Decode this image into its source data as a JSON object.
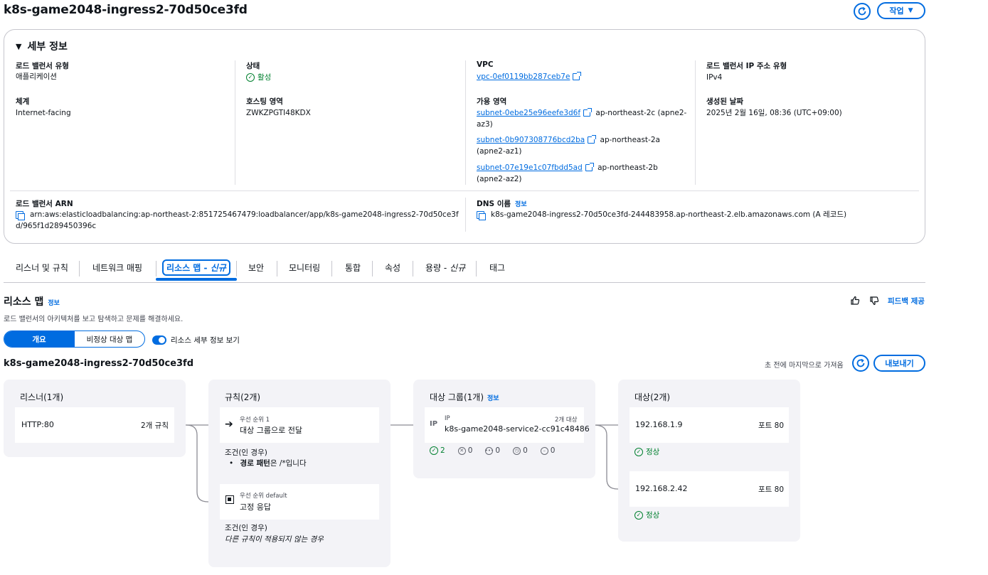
{
  "header": {
    "title": "k8s-game2048-ingress2-70d50ce3fd",
    "actions_label": "작업"
  },
  "details": {
    "heading": "세부 정보",
    "lb_type_label": "로드 밸런서 유형",
    "lb_type_value": "애플리케이션",
    "scheme_label": "체계",
    "scheme_value": "Internet-facing",
    "state_label": "상태",
    "state_value": "활성",
    "hosted_zone_label": "호스팅 영역",
    "hosted_zone_value": "ZWKZPGTI48KDX",
    "vpc_label": "VPC",
    "vpc_value": "vpc-0ef0119bb287ceb7e",
    "az_label": "가용 영역",
    "subnets": [
      {
        "id": "subnet-0ebe25e96eefe3d6f",
        "zone": "ap-northeast-2c (apne2-",
        "zone2": "az3)"
      },
      {
        "id": "subnet-0b907308776bcd2ba",
        "zone": "ap-northeast-2a",
        "zone2": "(apne2-az1)"
      },
      {
        "id": "subnet-07e19e1c07fbdd5ad",
        "zone": "ap-northeast-2b",
        "zone2": "(apne2-az2)"
      }
    ],
    "ip_type_label": "로드 밸런서 IP 주소 유형",
    "ip_type_value": "IPv4",
    "created_label": "생성된 날짜",
    "created_value": "2025년 2월 16일, 08:36 (UTC+09:00)",
    "arn_label": "로드 밸런서 ARN",
    "arn_line1": "arn:aws:elasticloadbalancing:ap-northeast-2:851725467479:loadbalancer/app/k8s-game2048-ingress2-70d50ce3f",
    "arn_line2": "d/965f1d289450396c",
    "dns_label": "DNS 이름",
    "dns_info": "정보",
    "dns_value": "k8s-game2048-ingress2-70d50ce3fd-244483958.ap-northeast-2.elb.amazonaws.com (A 레코드)"
  },
  "tabs": {
    "listeners": "리스너 및 규칙",
    "network": "네트워크 매핑",
    "resource_map": "리소스 맵 - ",
    "resource_map_new": "신규",
    "security": "보안",
    "monitoring": "모니터링",
    "integration": "통합",
    "attributes": "속성",
    "capacity": "용량 - ",
    "capacity_new": "신규",
    "tags": "태그"
  },
  "resource_map": {
    "heading": "리소스 맵",
    "info": "정보",
    "description": "로드 밸런서의 아키텍처를 보고 탐색하고 문제를 해결하세요.",
    "feedback": "피드백 제공",
    "seg_overview": "개요",
    "seg_unhealthy": "비정상 대상 맵",
    "toggle_label": "리소스 세부 정보 보기",
    "lb_name": "k8s-game2048-ingress2-70d50ce3fd",
    "last_fetched": "초 전에 마지막으로 가져옴",
    "export": "내보내기"
  },
  "listeners_col": {
    "title": "리스너(1개)",
    "listener": "HTTP:80",
    "rule_count": "2개 규칙"
  },
  "rules_col": {
    "title": "규칙(2개)",
    "rule1_priority": "우선 순위 1",
    "rule1_action": "대상 그룹으로 전달",
    "rule1_cond_label": "조건(인 경우)",
    "rule1_cond_bold": "경로 패턴",
    "rule1_cond_rest": "은 /*입니다",
    "rule2_priority": "우선 순위 default",
    "rule2_action": "고정 응답",
    "rule2_cond_label": "조건(인 경우)",
    "rule2_cond_text": "다른 규칙이 적용되지 않는 경우"
  },
  "tg_col": {
    "title": "대상 그룹(1개)",
    "info": "정보",
    "type": "IP",
    "target_count": "2개 대상",
    "name": "k8s-game2048-service2-cc91c48486",
    "healthy": "2",
    "unhealthy": "0",
    "unused": "0",
    "draining": "0",
    "unavailable": "0"
  },
  "targets_col": {
    "title": "대상(2개)",
    "targets": [
      {
        "ip": "192.168.1.9",
        "port": "포트 80",
        "status": "정상"
      },
      {
        "ip": "192.168.2.42",
        "port": "포트 80",
        "status": "정상"
      }
    ]
  },
  "colors": {
    "accent": "#006ce0",
    "success": "#00802f",
    "card_bg": "#f3f3f7"
  }
}
